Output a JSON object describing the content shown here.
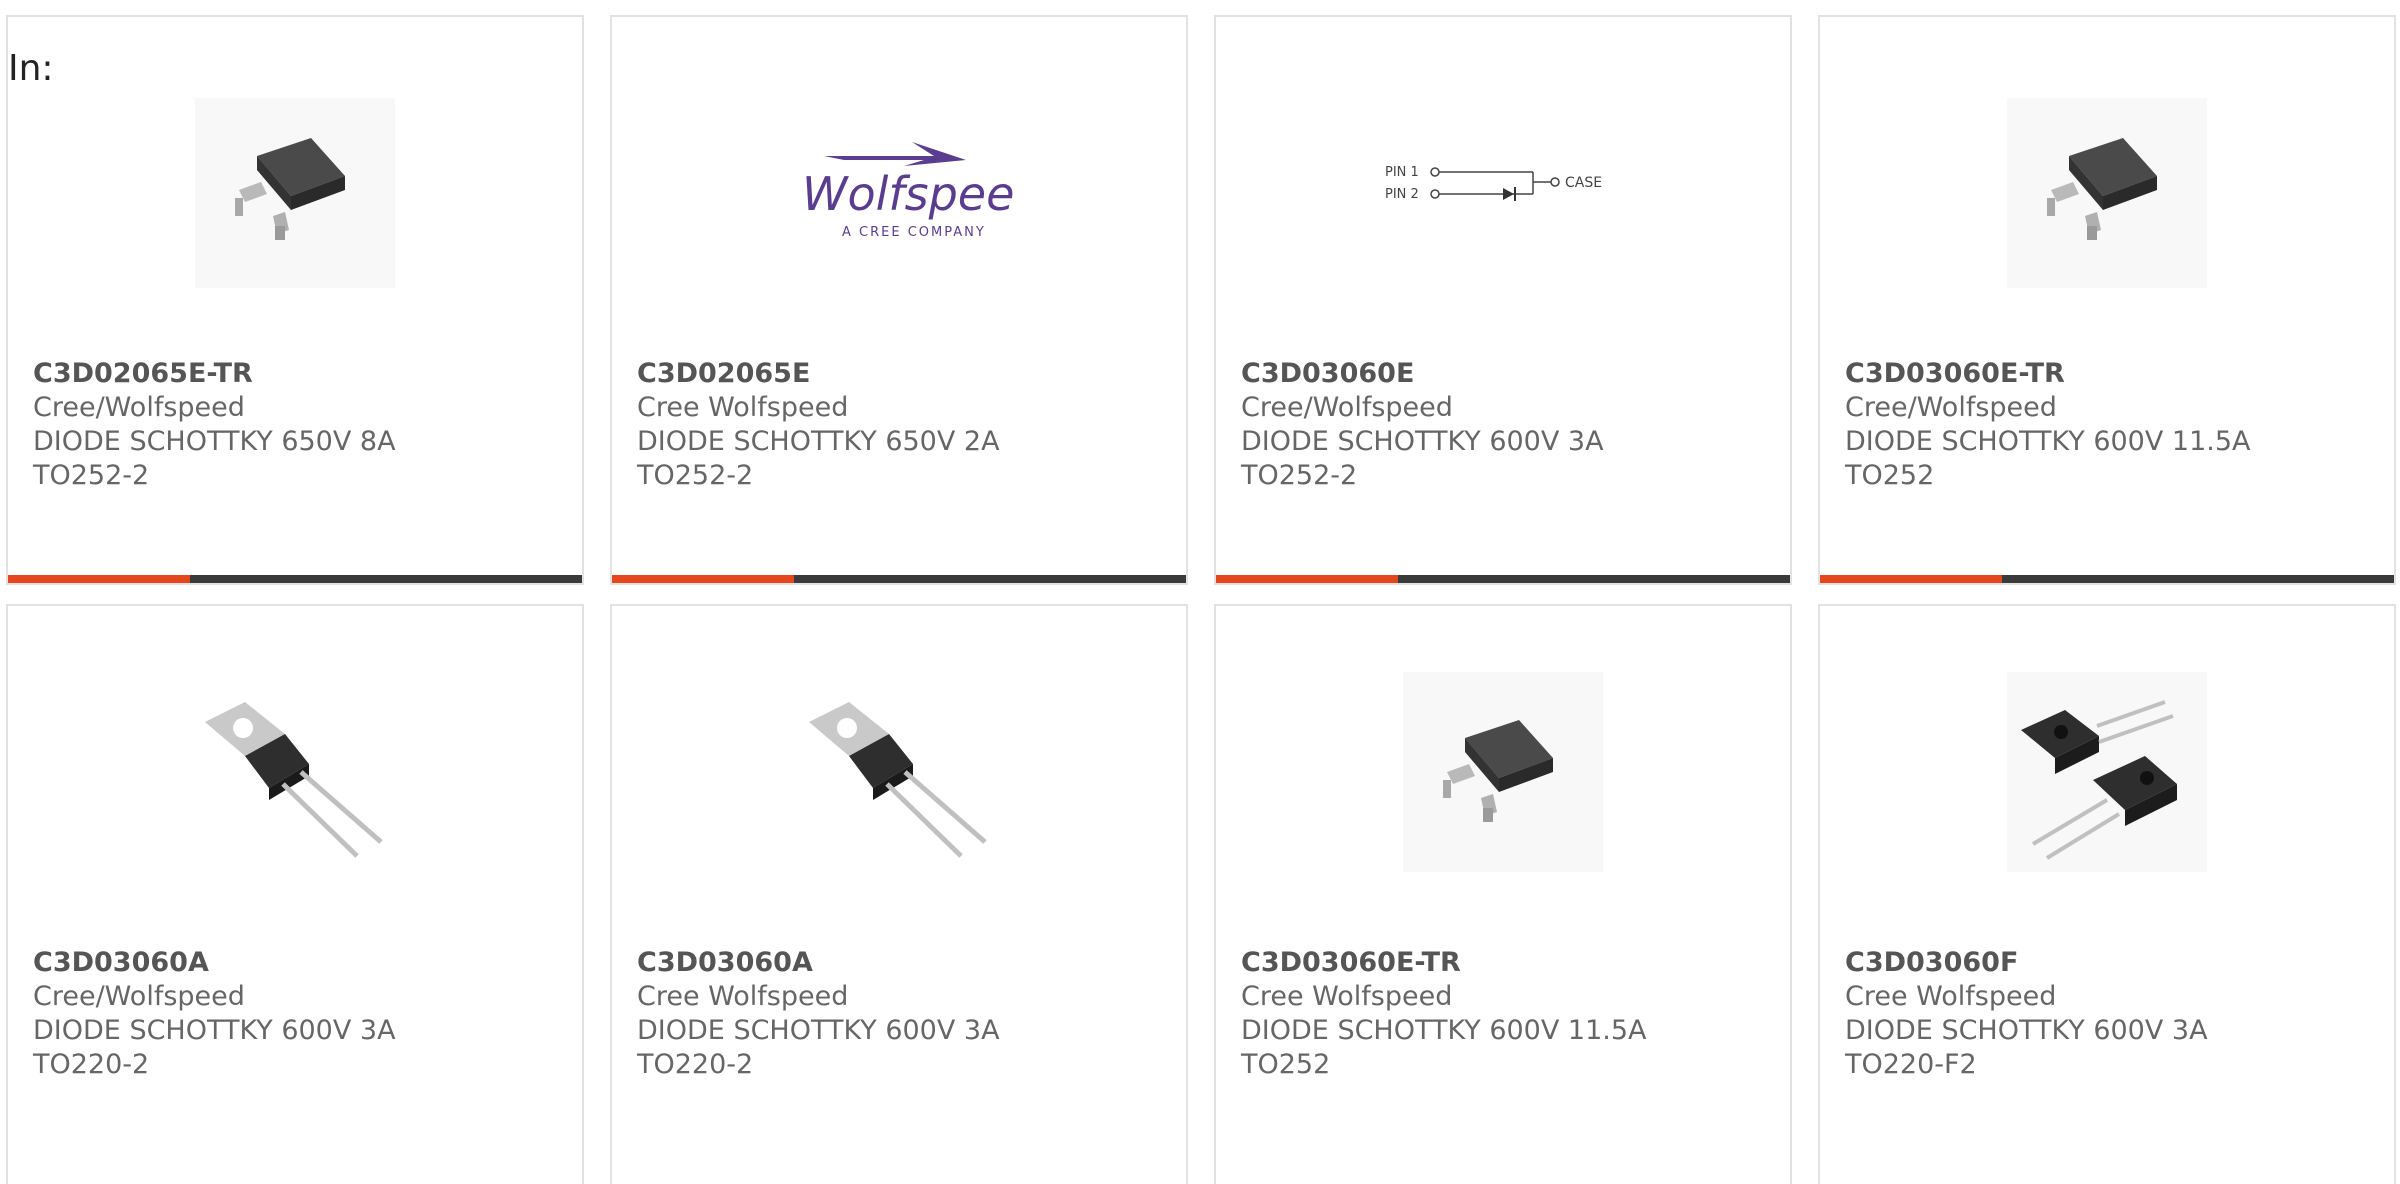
{
  "filter_label": "In:",
  "colors": {
    "accent": "#e5461b",
    "bar": "#3a3a3a",
    "border": "#e2e2e2",
    "wolfspeed_purple": "#5a3d8f"
  },
  "products": [
    {
      "part_number": "C3D02065E-TR",
      "manufacturer": "Cree/Wolfspeed",
      "description": "DIODE SCHOTTKY 650V 8A",
      "package": "TO252-2",
      "image": "to252-package"
    },
    {
      "part_number": "C3D02065E",
      "manufacturer": "Cree Wolfspeed",
      "description": "DIODE SCHOTTKY 650V 2A",
      "package": "TO252-2",
      "image": "wolfspeed-logo"
    },
    {
      "part_number": "C3D03060E",
      "manufacturer": "Cree/Wolfspeed",
      "description": "DIODE SCHOTTKY 600V 3A",
      "package": "TO252-2",
      "image": "pin-diagram"
    },
    {
      "part_number": "C3D03060E-TR",
      "manufacturer": "Cree/Wolfspeed",
      "description": "DIODE SCHOTTKY 600V 11.5A",
      "package": "TO252",
      "image": "to252-package"
    },
    {
      "part_number": "C3D03060A",
      "manufacturer": "Cree/Wolfspeed",
      "description": "DIODE SCHOTTKY 600V 3A",
      "package": "TO220-2",
      "image": "to220-package"
    },
    {
      "part_number": "C3D03060A",
      "manufacturer": "Cree Wolfspeed",
      "description": "DIODE SCHOTTKY 600V 3A",
      "package": "TO220-2",
      "image": "to220-package"
    },
    {
      "part_number": "C3D03060E-TR",
      "manufacturer": "Cree Wolfspeed",
      "description": "DIODE SCHOTTKY 600V 11.5A",
      "package": "TO252",
      "image": "to252-package"
    },
    {
      "part_number": "C3D03060F",
      "manufacturer": "Cree Wolfspeed",
      "description": "DIODE SCHOTTKY 600V 3A",
      "package": "TO220-F2",
      "image": "to220f-packages"
    }
  ],
  "logo": {
    "brand": "Wolfspeed.",
    "tagline": "A CREE COMPANY"
  },
  "pin_diagram": {
    "pin1": "PIN 1",
    "pin2": "PIN 2",
    "case": "CASE"
  }
}
